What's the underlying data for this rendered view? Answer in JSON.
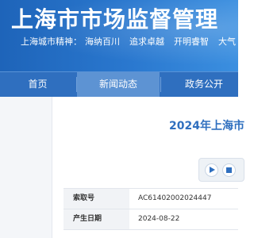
{
  "header": {
    "title": "上海市市场监督管理",
    "slogan_label": "上海城市精神：",
    "slogans": [
      "海纳百川",
      "追求卓越",
      "开明睿智",
      "大气"
    ]
  },
  "nav": {
    "items": [
      {
        "label": "首页"
      },
      {
        "label": "新闻动态"
      },
      {
        "label": "政务公开"
      }
    ],
    "active": "新闻动态"
  },
  "article": {
    "title": "2024年上海市"
  },
  "metadata": [
    {
      "key": "索取号",
      "value": "AC61402002024447"
    },
    {
      "key": "产生日期",
      "value": "2024-08-22"
    }
  ],
  "colors": {
    "brand_blue": "#2f6fbf",
    "nav_active": "#5d93d3"
  },
  "icons": {
    "play": "play-icon",
    "stop": "stop-icon"
  }
}
